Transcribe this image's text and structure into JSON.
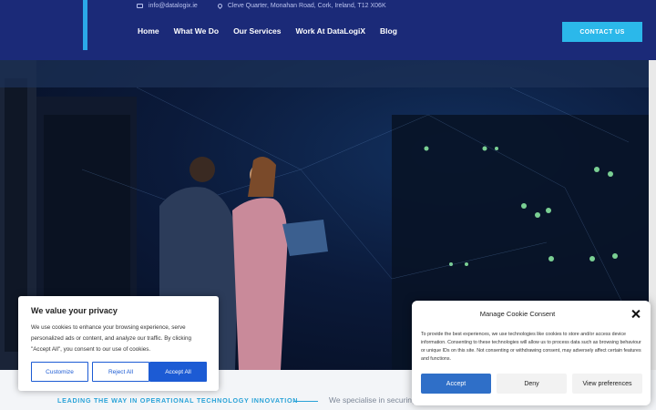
{
  "header": {
    "email": "info@datalogix.ie",
    "address": "Cleve Quarter, Monahan Road, Cork, Ireland, T12 X06K",
    "nav": [
      "Home",
      "What We Do",
      "Our Services",
      "Work At DataLogiX",
      "Blog"
    ],
    "cta_label": "CONTACT US"
  },
  "intro": {
    "tagline": "LEADING THE WAY IN OPERATIONAL TECHNOLOGY INNOVATION",
    "text": "We specialise in securing"
  },
  "privacy_banner": {
    "title": "We value your privacy",
    "body": "We use cookies to enhance your browsing experience, serve personalized ads or content, and analyze our traffic. By clicking \"Accept All\", you consent to our use of cookies.",
    "customize_label": "Customize",
    "reject_label": "Reject All",
    "accept_label": "Accept All"
  },
  "consent_dialog": {
    "title": "Manage Cookie Consent",
    "body": "To provide the best experiences, we use technologies like cookies to store and/or access device information. Consenting to these technologies will allow us to process data such as browsing behaviour or unique IDs on this site. Not consenting or withdrawing consent, may adversely affect certain features and functions.",
    "accept_label": "Accept",
    "deny_label": "Deny",
    "preferences_label": "View preferences"
  },
  "colors": {
    "header_bg": "#1b2a78",
    "accent": "#2bb8ea",
    "button_blue": "#1c5bd4",
    "consent_blue": "#2f6fc8"
  },
  "icons": {
    "email": "mail-icon",
    "address": "location-pin-icon",
    "close": "close-icon"
  }
}
